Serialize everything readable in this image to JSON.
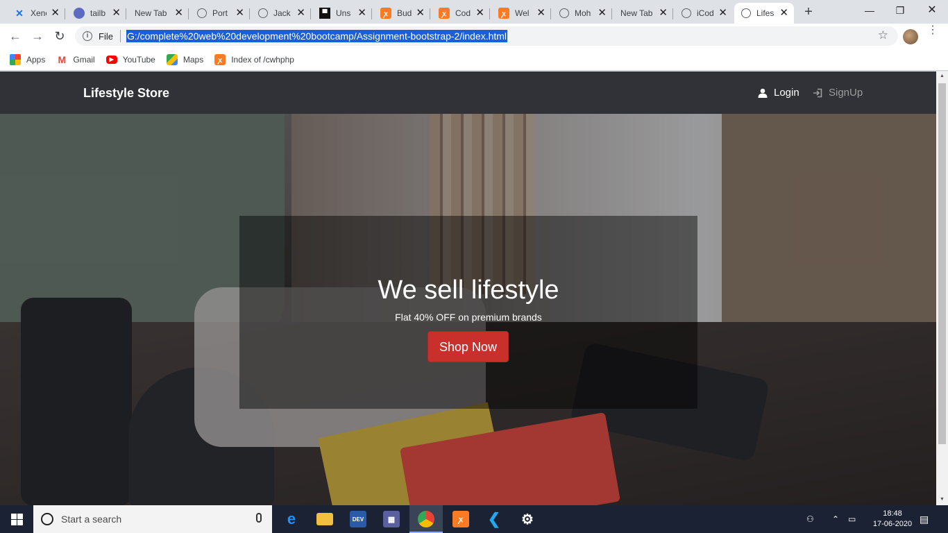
{
  "browser": {
    "tabs": [
      {
        "title": "Xeno",
        "icon": "xeno-icon"
      },
      {
        "title": "tailb",
        "icon": "tailblocks-icon"
      },
      {
        "title": "New Tab",
        "icon": "none"
      },
      {
        "title": "Port",
        "icon": "globe-icon"
      },
      {
        "title": "Jack",
        "icon": "globe-icon"
      },
      {
        "title": "Uns",
        "icon": "unsplash-icon"
      },
      {
        "title": "Bud",
        "icon": "xampp-icon"
      },
      {
        "title": "Cod",
        "icon": "xampp-icon"
      },
      {
        "title": "Wel",
        "icon": "xampp-icon"
      },
      {
        "title": "Moh",
        "icon": "globe-icon"
      },
      {
        "title": "New Tab",
        "icon": "none"
      },
      {
        "title": "iCod",
        "icon": "globe-icon"
      },
      {
        "title": "Lifes",
        "icon": "globe-icon",
        "active": true
      }
    ],
    "close_glyph": "✕",
    "new_tab_glyph": "+",
    "window_controls": {
      "minimize": "—",
      "maximize": "❐",
      "close": "✕"
    },
    "toolbar": {
      "back": "←",
      "forward": "→",
      "reload": "↻",
      "scheme_label": "File",
      "url": "G:/complete%20web%20development%20bootcamp/Assignment-bootstrap-2/index.html",
      "star": "☆",
      "menu": "⋮"
    },
    "bookmarks": [
      {
        "label": "Apps",
        "icon": "apps-grid-icon"
      },
      {
        "label": "Gmail",
        "icon": "gmail-icon"
      },
      {
        "label": "YouTube",
        "icon": "youtube-icon"
      },
      {
        "label": "Maps",
        "icon": "maps-icon"
      },
      {
        "label": "Index of /cwhphp",
        "icon": "xampp-icon"
      }
    ]
  },
  "page": {
    "brand": "Lifestyle Store",
    "nav": {
      "login": "Login",
      "signup": "SignUp"
    },
    "hero": {
      "heading": "We sell lifestyle",
      "subheading": "Flat 40% OFF on premium brands",
      "button": "Shop Now"
    },
    "colors": {
      "navbar_bg": "#303238",
      "button_bg": "#c9302c",
      "signup_text": "#9d9d9d"
    }
  },
  "taskbar": {
    "search_placeholder": "Start a search",
    "apps": [
      "edge-icon",
      "file-explorer-icon",
      "dev-tools-icon",
      "calculator-icon",
      "chrome-icon",
      "xampp-icon",
      "vscode-icon",
      "settings-icon"
    ],
    "clock_time": "18:48",
    "clock_date": "17-06-2020"
  }
}
